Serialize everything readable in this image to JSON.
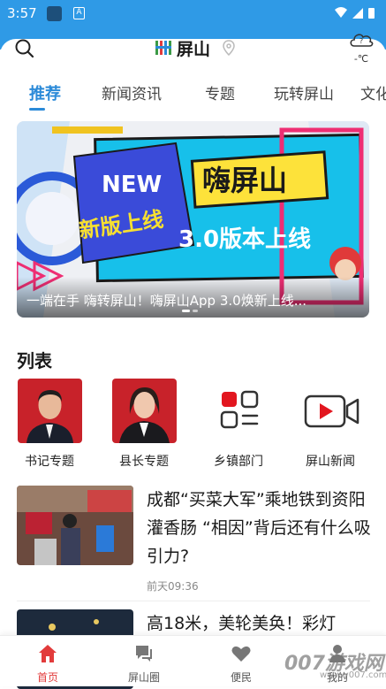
{
  "status_bar": {
    "time": "3:57",
    "notif_letter": "A"
  },
  "header": {
    "brand": "屏山",
    "weather_temp": "-℃",
    "weather_badge": "?"
  },
  "tabs": [
    {
      "label": "推荐",
      "active": true
    },
    {
      "label": "新闻资讯"
    },
    {
      "label": "专题"
    },
    {
      "label": "玩转屏山"
    },
    {
      "label": "文化"
    }
  ],
  "banner": {
    "caption": "一端在手 嗨转屏山！嗨屏山App 3.0焕新上线...",
    "art_new": "NEW",
    "art_tag": "新版上线",
    "art_title": "嗨屏山",
    "art_sub": "3.0版本上线"
  },
  "list_section": {
    "title": "列表",
    "items": [
      {
        "label": "书记专题"
      },
      {
        "label": "县长专题"
      },
      {
        "label": "乡镇部门"
      },
      {
        "label": "屏山新闻"
      }
    ]
  },
  "news": [
    {
      "title": "成都“买菜大军”乘地铁到资阳灌香肠 “相因”背后还有什么吸引力?",
      "time": "前天09:36"
    },
    {
      "title": "高18米，美轮美奂！彩灯"
    }
  ],
  "bottom_nav": [
    {
      "label": "首页",
      "active": true
    },
    {
      "label": "屏山圈"
    },
    {
      "label": "便民"
    },
    {
      "label": "我的"
    }
  ],
  "watermark": {
    "main": "007游戏网",
    "sub": "www.y007.com"
  },
  "colors": {
    "accent": "#2b8ad8",
    "status_bar": "#2f9ae6",
    "nav_active": "#e23b3b"
  }
}
